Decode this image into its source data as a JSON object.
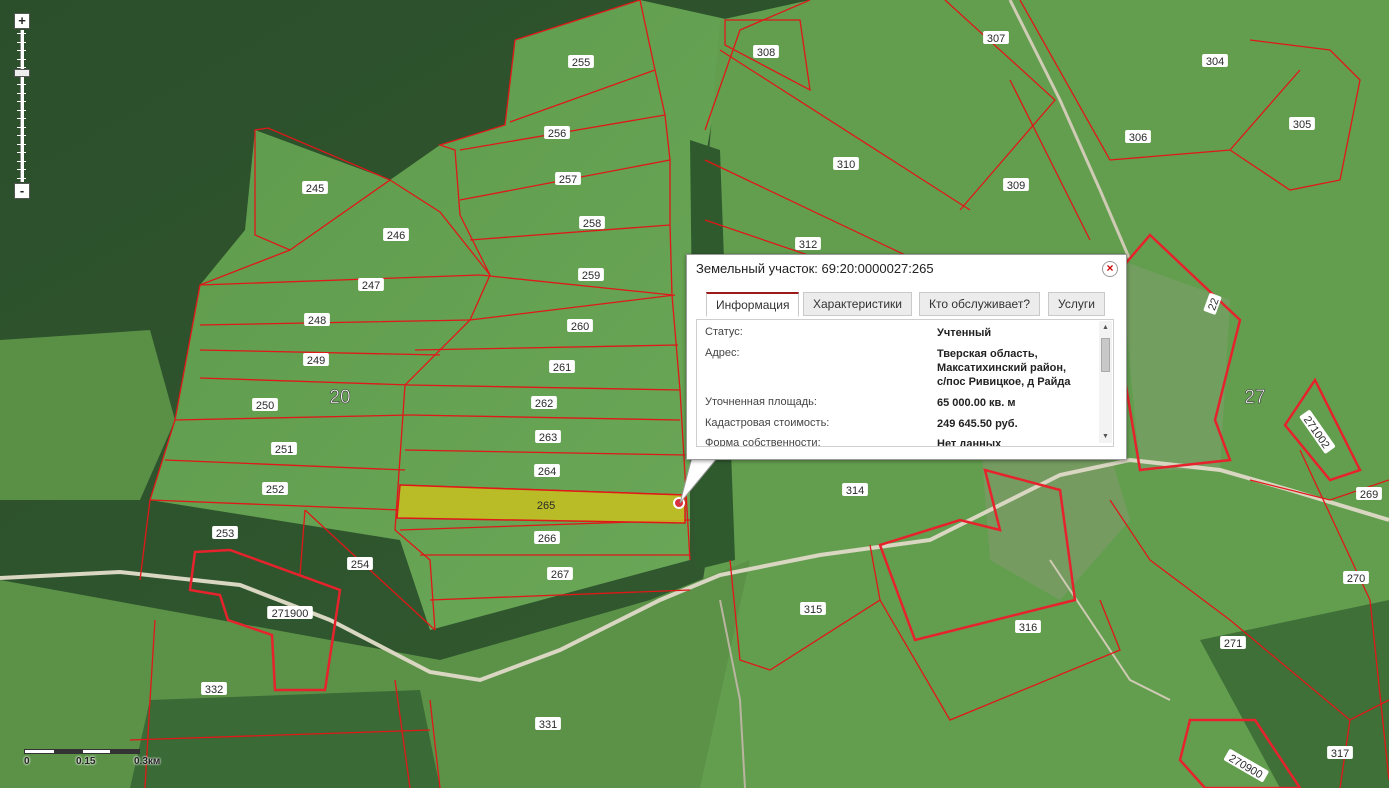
{
  "map": {
    "colors": {
      "forest": "#2f5a2e",
      "field": "#5f9a4c",
      "parcel_border": "#e01818",
      "selected_fill": "#c8c020",
      "road": "#d8d4c0"
    },
    "quarter_labels": [
      "20",
      "27"
    ],
    "plot_labels": [
      "255",
      "256",
      "257",
      "258",
      "259",
      "260",
      "261",
      "262",
      "263",
      "264",
      "265",
      "266",
      "267",
      "245",
      "246",
      "247",
      "248",
      "249",
      "250",
      "251",
      "252",
      "253",
      "254",
      "271900",
      "332",
      "331",
      "308",
      "307",
      "304",
      "305",
      "306",
      "310",
      "309",
      "312",
      "314",
      "315",
      "316",
      "317",
      "22",
      "271002",
      "269",
      "270",
      "271",
      "270900"
    ],
    "selected_plot": "265"
  },
  "zoom": {
    "plus_label": "+",
    "minus_label": "-"
  },
  "scale": {
    "labels": [
      "0",
      "0.15",
      "0.3км"
    ]
  },
  "popup": {
    "title": "Земельный участок: 69:20:0000027:265",
    "close_label": "×",
    "tabs": [
      "Информация",
      "Характеристики",
      "Кто обслуживает?",
      "Услуги"
    ],
    "active_tab": "Информация",
    "rows": [
      {
        "key": "Статус:",
        "value": "Учтенный"
      },
      {
        "key": "Адрес:",
        "value": "Тверская область, Максатихинский район, с/пос Ривицкое, д Райда"
      },
      {
        "key": "Уточненная площадь:",
        "value": "65 000.00 кв. м"
      },
      {
        "key": "Кадастровая стоимость:",
        "value": "249 645.50 руб."
      },
      {
        "key": "Форма собственности:",
        "value": "Нет данных"
      }
    ]
  }
}
